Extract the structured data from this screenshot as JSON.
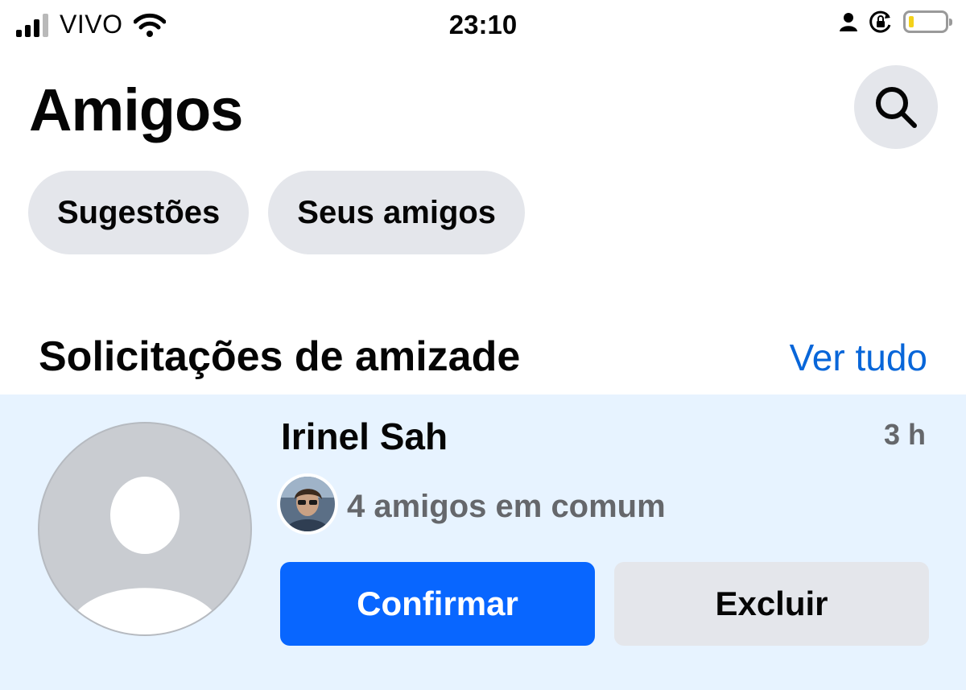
{
  "status_bar": {
    "carrier": "VIVO",
    "time": "23:10",
    "signal_bars_active": 3,
    "battery_level": 0.15,
    "icons": [
      "signal-icon",
      "wifi-icon",
      "person-icon",
      "rotation-lock-icon",
      "battery-icon"
    ]
  },
  "header": {
    "title": "Amigos",
    "search_icon": "search-icon"
  },
  "chips": [
    {
      "label": "Sugestões"
    },
    {
      "label": "Seus amigos"
    }
  ],
  "requests_section": {
    "title": "Solicitações de amizade",
    "see_all_label": "Ver tudo",
    "link_color": "#0866d9",
    "card_background": "#e7f3ff",
    "requests": [
      {
        "name": "Irinel Sah",
        "time": "3 h",
        "mutual_friends": "4 amigos em comum",
        "confirm_label": "Confirmar",
        "delete_label": "Excluir"
      }
    ]
  },
  "colors": {
    "primary": "#0866ff",
    "chip_background": "#e4e6eb",
    "secondary_text": "#65676b"
  }
}
